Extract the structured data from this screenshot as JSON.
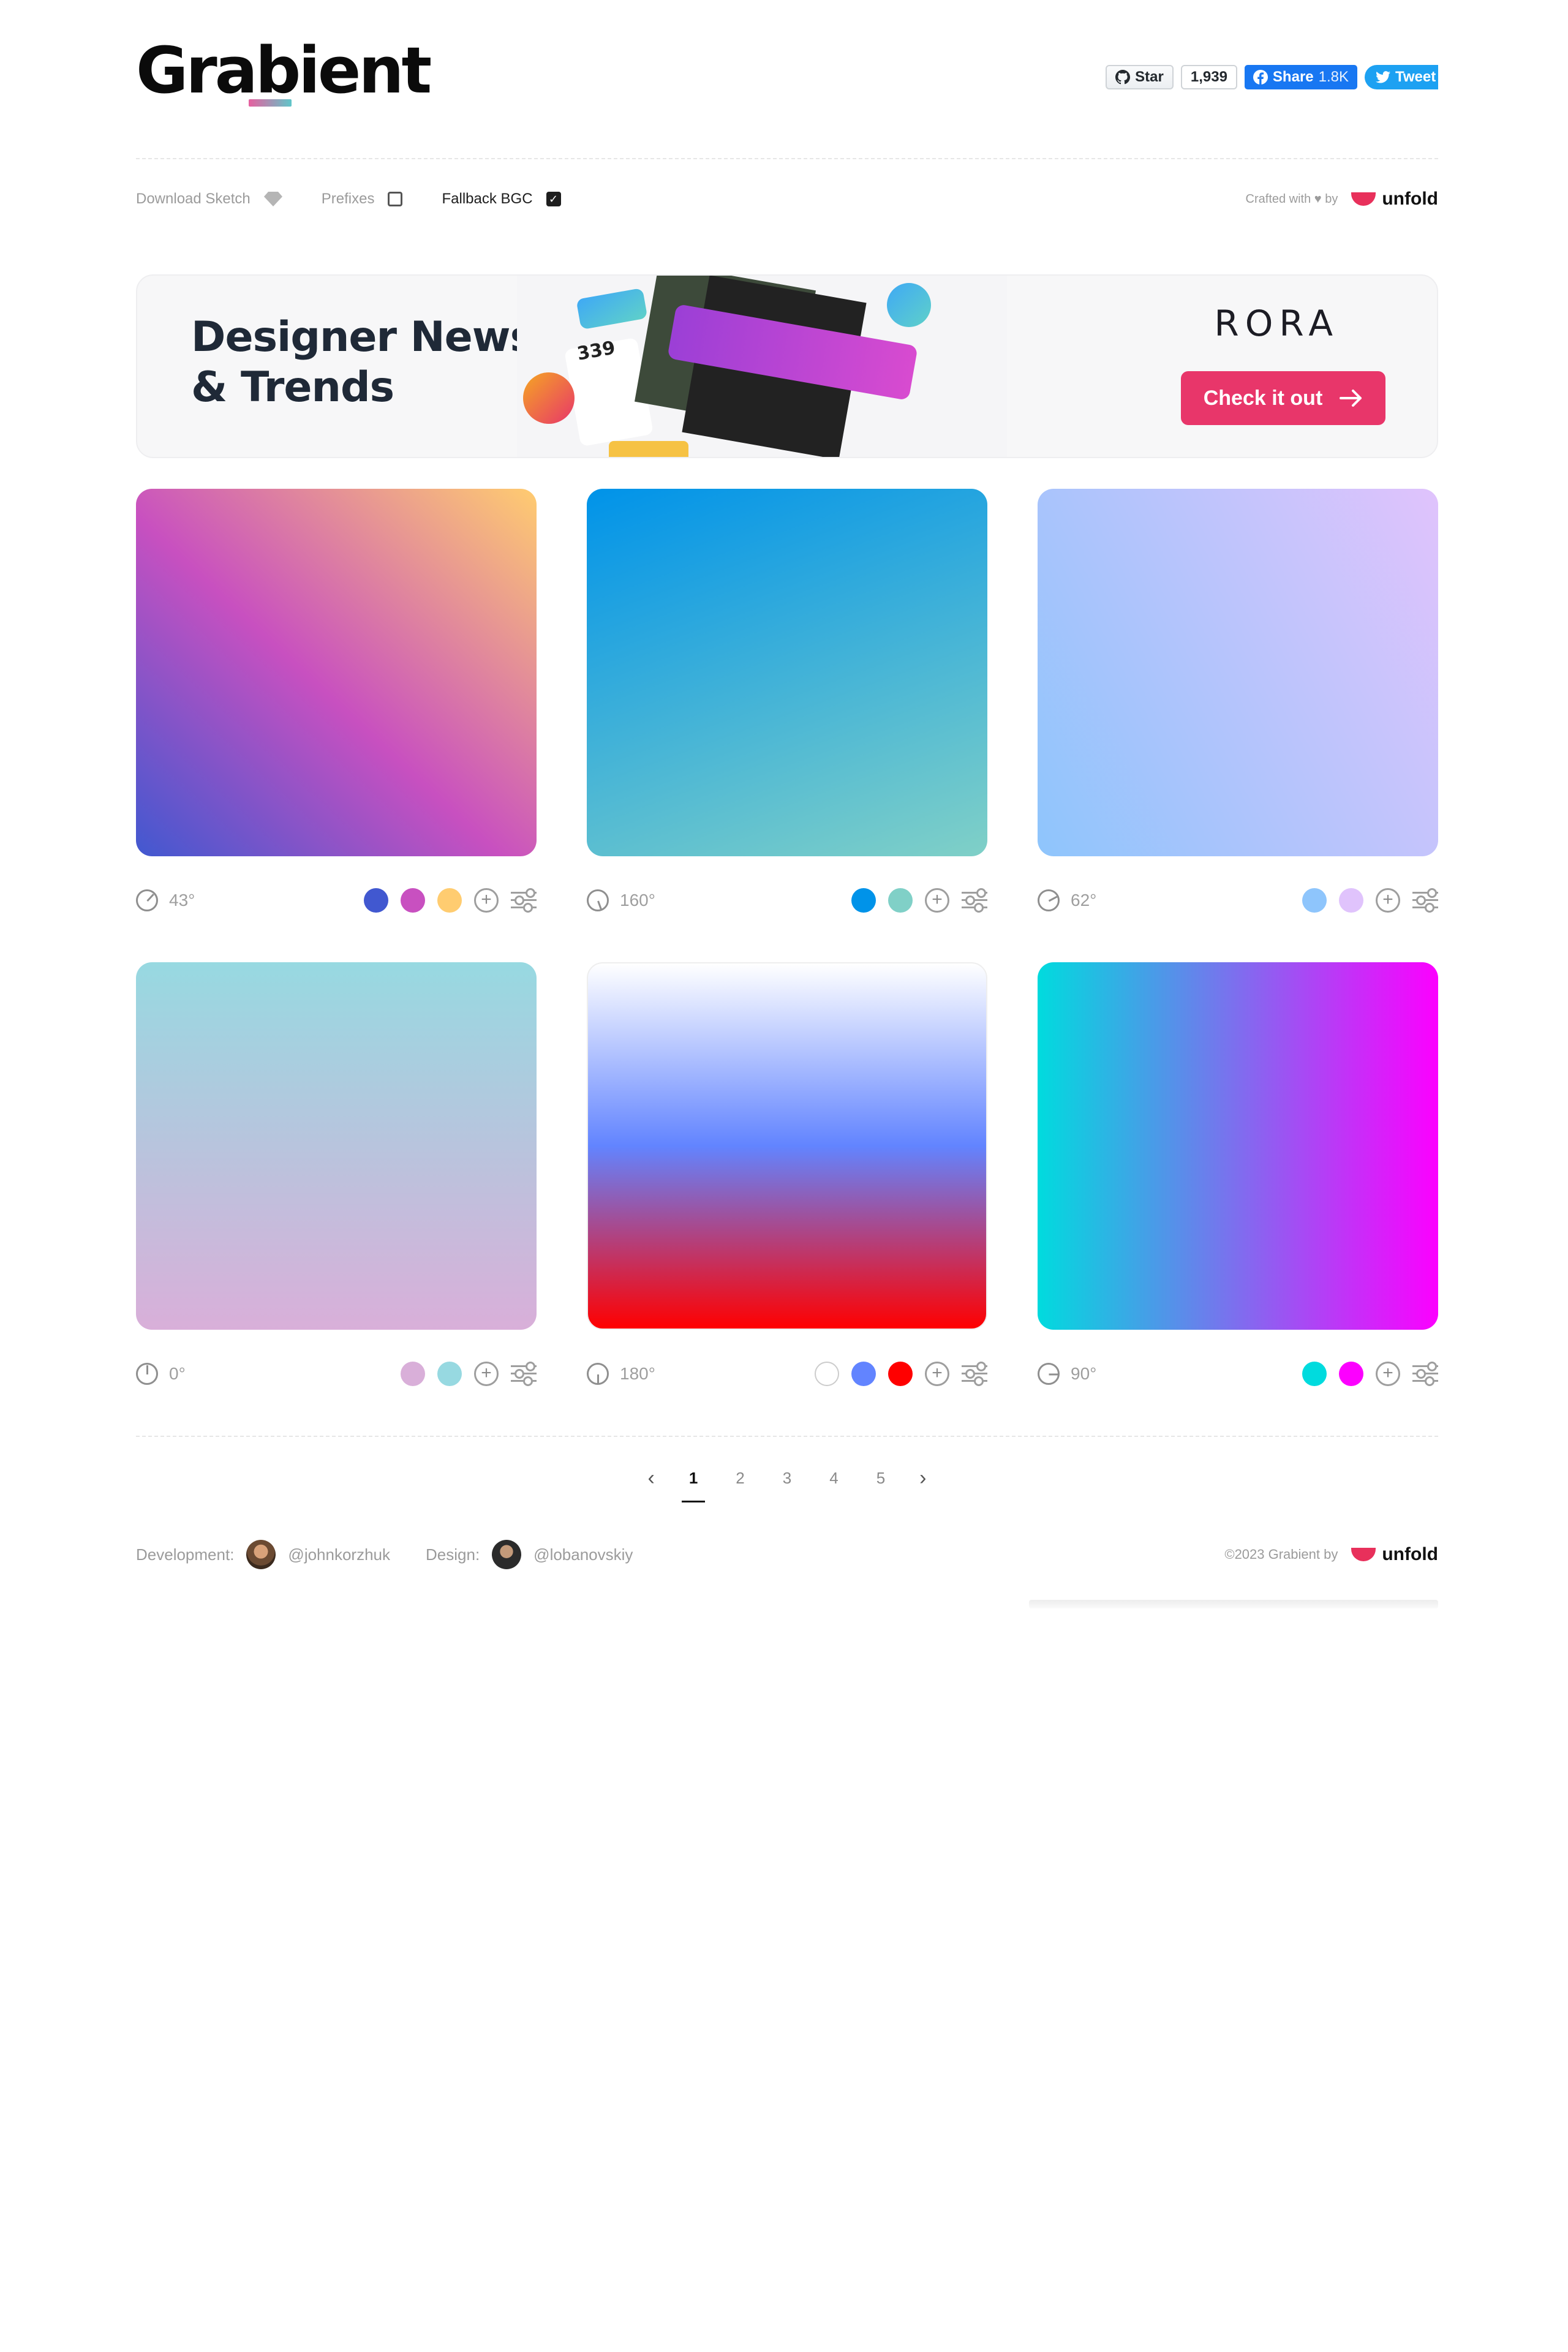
{
  "header": {
    "logo": "Grabient",
    "github": {
      "star_label": "Star",
      "star_count": "1,939"
    },
    "facebook": {
      "label": "Share",
      "count": "1.8K"
    },
    "twitter": {
      "label": "Tweet"
    }
  },
  "options": {
    "download_sketch": "Download Sketch",
    "prefixes": "Prefixes",
    "prefixes_checked": false,
    "fallback_bgc": "Fallback BGC",
    "fallback_checked": true,
    "crafted_by": "Crafted with ♥ by",
    "brand": "unfold"
  },
  "banner": {
    "title_line1": "Designer News",
    "title_line2": "& Trends",
    "brand": "RORA",
    "cta": "Check it out"
  },
  "gradients": [
    {
      "angle": "43°",
      "css": "linear-gradient(43deg,#4158D0 0%,#C850C0 46%,#FFCC70 100%)",
      "colors": [
        "#4158D0",
        "#C850C0",
        "#FFCC70"
      ]
    },
    {
      "angle": "160°",
      "css": "linear-gradient(160deg,#0093E9 0%,#80D0C7 100%)",
      "colors": [
        "#0093E9",
        "#80D0C7"
      ]
    },
    {
      "angle": "62°",
      "css": "linear-gradient(62deg,#8EC5FC 0%,#E0C3FC 100%)",
      "colors": [
        "#8EC5FC",
        "#E0C3FC"
      ]
    },
    {
      "angle": "0°",
      "css": "linear-gradient(0deg,#D9AFD9 0%,#97D9E1 100%)",
      "colors": [
        "#D9AFD9",
        "#97D9E1"
      ]
    },
    {
      "angle": "180°",
      "css": "linear-gradient(180deg,#FFFFFF 0%,#6284FF 50%,#FF0000 100%)",
      "colors": [
        "#FFFFFF",
        "#6284FF",
        "#FF0000"
      ]
    },
    {
      "angle": "90°",
      "css": "linear-gradient(90deg,#00DBDE 0%,#FC00FF 100%)",
      "colors": [
        "#00DBDE",
        "#FC00FF"
      ]
    }
  ],
  "pagination": {
    "pages": [
      "1",
      "2",
      "3",
      "4",
      "5"
    ],
    "current": "1"
  },
  "footer": {
    "dev_label": "Development:",
    "dev_handle": "@johnkorzhuk",
    "design_label": "Design:",
    "design_handle": "@lobanovskiy",
    "copyright": "©2023 Grabient by",
    "brand": "unfold"
  }
}
